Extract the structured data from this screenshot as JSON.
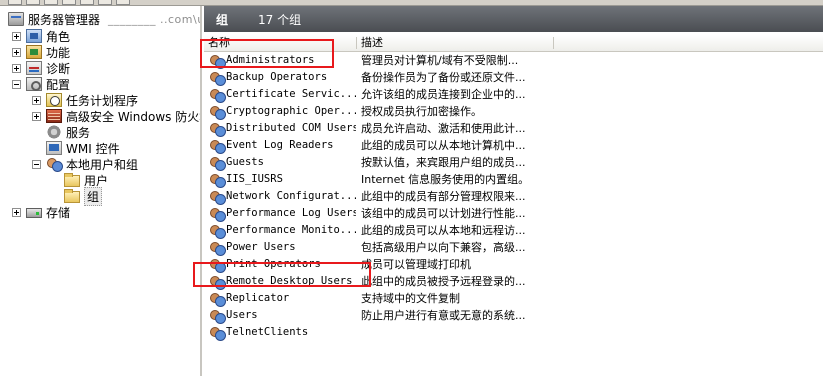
{
  "tree": {
    "root": "服务器管理器",
    "root_suffix": "________ ..com\\u0Q",
    "roles": "角色",
    "features": "功能",
    "diagnostics": "诊断",
    "configuration": "配置",
    "task_scheduler": "任务计划程序",
    "firewall": "高级安全 Windows 防火墙",
    "services": "服务",
    "wmi": "WMI 控件",
    "local_users_groups": "本地用户和组",
    "users": "用户",
    "groups": "组",
    "storage": "存储"
  },
  "panel": {
    "title": "组",
    "count": "17 个组"
  },
  "columns": {
    "name": "名称",
    "description": "描述"
  },
  "groups": [
    {
      "name": "Administrators",
      "desc": "管理员对计算机/域有不受限制..."
    },
    {
      "name": "Backup Operators",
      "desc": "备份操作员为了备份或还原文件..."
    },
    {
      "name": "Certificate Servic...",
      "desc": "允许该组的成员连接到企业中的..."
    },
    {
      "name": "Cryptographic Oper...",
      "desc": "授权成员执行加密操作。"
    },
    {
      "name": "Distributed COM Users",
      "desc": "成员允许启动、激活和使用此计..."
    },
    {
      "name": "Event Log Readers",
      "desc": "此组的成员可以从本地计算机中..."
    },
    {
      "name": "Guests",
      "desc": "按默认值，来宾跟用户组的成员..."
    },
    {
      "name": "IIS_IUSRS",
      "desc": "Internet 信息服务使用的内置组。"
    },
    {
      "name": "Network Configurat...",
      "desc": "此组中的成员有部分管理权限来..."
    },
    {
      "name": "Performance Log Users",
      "desc": "该组中的成员可以计划进行性能..."
    },
    {
      "name": "Performance Monito...",
      "desc": "此组的成员可以从本地和远程访..."
    },
    {
      "name": "Power Users",
      "desc": "包括高级用户以向下兼容，高级..."
    },
    {
      "name": "Print Operators",
      "desc": "成员可以管理域打印机"
    },
    {
      "name": "Remote Desktop Users",
      "desc": "此组中的成员被授予远程登录的..."
    },
    {
      "name": "Replicator",
      "desc": "支持域中的文件复制"
    },
    {
      "name": "Users",
      "desc": "防止用户进行有意或无意的系统..."
    },
    {
      "name": "TelnetClients",
      "desc": ""
    }
  ],
  "highlight_color": "#e8191c"
}
